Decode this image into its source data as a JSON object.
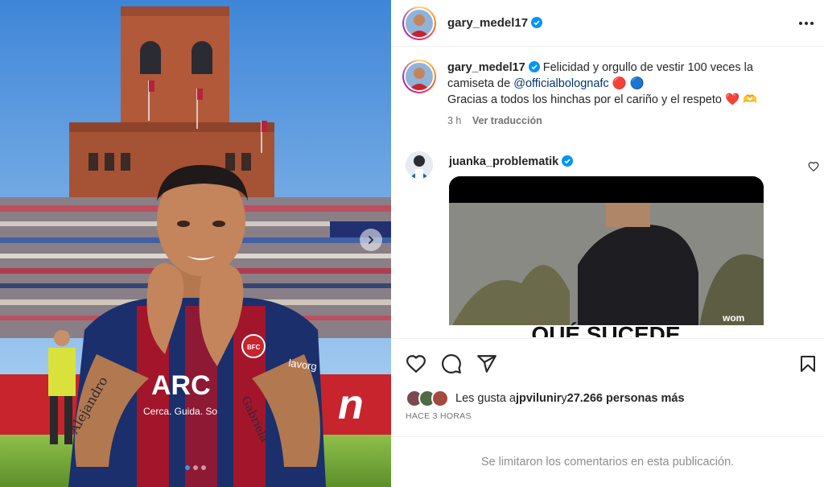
{
  "post": {
    "username": "gary_medel17",
    "caption_line1": "Felicidad y orgullo de vestir 100 veces la",
    "caption_line2_prefix": "camiseta de ",
    "caption_mention": "@officialbolognafc",
    "caption_emoji_1": "🔴",
    "caption_emoji_2": "🔵",
    "caption_line3": "Gracias a todos los hinchas por el cariño y el respeto",
    "caption_emoji_3": "❤️",
    "caption_emoji_4": "🫶",
    "time": "3 h",
    "translate_label": "Ver traducción"
  },
  "photo": {
    "shirt_sponsor": "ARC",
    "shirt_tagline": "Cerca. Guida. So",
    "sleeve_brand": "lavorg",
    "crest_text": "BFC",
    "tattoo_left": "Alejandro",
    "tattoo_right": "Gabriela",
    "slide_count": 3,
    "active_slide": 1
  },
  "comment": {
    "username": "juanka_problematik",
    "gif_text": "QUÉ SUCEDE",
    "gif_brand": "wom"
  },
  "likes": {
    "prefix": "Les gusta a ",
    "user": "jpvilunir",
    "middle": " y ",
    "count_text": "27.266 personas más"
  },
  "timestamp": "HACE 3 HORAS",
  "comments_limited": "Se limitaron los comentarios en esta publicación.",
  "icons": [
    "verified-badge-icon",
    "more-options-icon",
    "heart-icon",
    "comment-icon",
    "share-icon",
    "bookmark-icon",
    "chevron-right-icon"
  ],
  "colors": {
    "verified": "#0095f6",
    "mention": "#00376b",
    "muted": "#737373",
    "jersey_blue": "#1a2f6b",
    "jersey_red": "#a3152b"
  }
}
